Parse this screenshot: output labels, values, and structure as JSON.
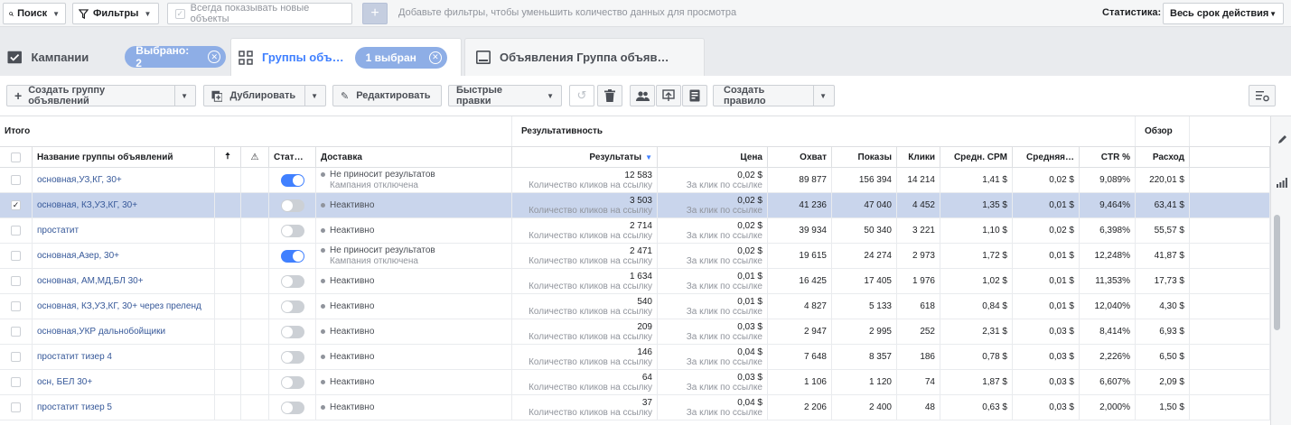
{
  "topbar": {
    "search_label": "Поиск",
    "filters_label": "Фильтры",
    "always_show_label": "Всегда показывать новые объекты",
    "add_filter_hint": "Добавьте фильтры, чтобы уменьшить количество данных для просмотра",
    "stats_label": "Статистика:",
    "stats_value": "Весь срок действия"
  },
  "tabs": {
    "campaigns": "Кампании",
    "campaigns_selected": "Выбрано: 2",
    "adsets": "Группы объ…",
    "adsets_selected": "1 выбран",
    "ads": "Объявления Группа объяв…"
  },
  "toolbar": {
    "create": "Создать группу объявлений",
    "duplicate": "Дублировать",
    "edit": "Редактировать",
    "quick_edit": "Быстрые правки",
    "create_rule": "Создать правило"
  },
  "table": {
    "band": {
      "total": "Итого",
      "performance": "Результативность",
      "overview": "Обзор"
    },
    "headers": {
      "name": "Название группы объявлений",
      "status": "Стат…",
      "delivery": "Доставка",
      "results": "Результаты",
      "price": "Цена",
      "reach": "Охват",
      "impressions": "Показы",
      "clicks": "Клики",
      "cpm": "Средн. CPM",
      "avg": "Средняя…",
      "ctr": "CTR %",
      "spend": "Расход"
    },
    "rows": [
      {
        "name": "основная,УЗ,КГ, 30+",
        "on": true,
        "selected": false,
        "d1": "Не приносит результатов",
        "d2": "Кампания отключена",
        "results": "12 583",
        "results_sub": "Количество кликов на ссылку",
        "price": "0,02 $",
        "price_sub": "За клик по ссылке",
        "reach": "89 877",
        "impr": "156 394",
        "clicks": "14 214",
        "cpm": "1,41 $",
        "avg": "0,02 $",
        "ctr": "9,089%",
        "spend": "220,01 $"
      },
      {
        "name": "основная, КЗ,УЗ,КГ, 30+",
        "on": false,
        "selected": true,
        "d1": "Неактивно",
        "d2": "",
        "results": "3 503",
        "results_sub": "Количество кликов на ссылку",
        "price": "0,02 $",
        "price_sub": "За клик по ссылке",
        "reach": "41 236",
        "impr": "47 040",
        "clicks": "4 452",
        "cpm": "1,35 $",
        "avg": "0,01 $",
        "ctr": "9,464%",
        "spend": "63,41 $"
      },
      {
        "name": "простатит",
        "on": false,
        "selected": false,
        "d1": "Неактивно",
        "d2": "",
        "results": "2 714",
        "results_sub": "Количество кликов на ссылку",
        "price": "0,02 $",
        "price_sub": "За клик по ссылке",
        "reach": "39 934",
        "impr": "50 340",
        "clicks": "3 221",
        "cpm": "1,10 $",
        "avg": "0,02 $",
        "ctr": "6,398%",
        "spend": "55,57 $"
      },
      {
        "name": "основная,Азер, 30+",
        "on": true,
        "selected": false,
        "d1": "Не приносит результатов",
        "d2": "Кампания отключена",
        "results": "2 471",
        "results_sub": "Количество кликов на ссылку",
        "price": "0,02 $",
        "price_sub": "За клик по ссылке",
        "reach": "19 615",
        "impr": "24 274",
        "clicks": "2 973",
        "cpm": "1,72 $",
        "avg": "0,01 $",
        "ctr": "12,248%",
        "spend": "41,87 $"
      },
      {
        "name": "основная, АМ,МД,БЛ 30+",
        "on": false,
        "selected": false,
        "d1": "Неактивно",
        "d2": "",
        "results": "1 634",
        "results_sub": "Количество кликов на ссылку",
        "price": "0,01 $",
        "price_sub": "За клик по ссылке",
        "reach": "16 425",
        "impr": "17 405",
        "clicks": "1 976",
        "cpm": "1,02 $",
        "avg": "0,01 $",
        "ctr": "11,353%",
        "spend": "17,73 $"
      },
      {
        "name": "основная, КЗ,УЗ,КГ, 30+ через преленд",
        "on": false,
        "selected": false,
        "d1": "Неактивно",
        "d2": "",
        "results": "540",
        "results_sub": "Количество кликов на ссылку",
        "price": "0,01 $",
        "price_sub": "За клик по ссылке",
        "reach": "4 827",
        "impr": "5 133",
        "clicks": "618",
        "cpm": "0,84 $",
        "avg": "0,01 $",
        "ctr": "12,040%",
        "spend": "4,30 $"
      },
      {
        "name": "основная,УКР дальнобойщики",
        "on": false,
        "selected": false,
        "d1": "Неактивно",
        "d2": "",
        "results": "209",
        "results_sub": "Количество кликов на ссылку",
        "price": "0,03 $",
        "price_sub": "За клик по ссылке",
        "reach": "2 947",
        "impr": "2 995",
        "clicks": "252",
        "cpm": "2,31 $",
        "avg": "0,03 $",
        "ctr": "8,414%",
        "spend": "6,93 $"
      },
      {
        "name": "простатит тизер 4",
        "on": false,
        "selected": false,
        "d1": "Неактивно",
        "d2": "",
        "results": "146",
        "results_sub": "Количество кликов на ссылку",
        "price": "0,04 $",
        "price_sub": "За клик по ссылке",
        "reach": "7 648",
        "impr": "8 357",
        "clicks": "186",
        "cpm": "0,78 $",
        "avg": "0,03 $",
        "ctr": "2,226%",
        "spend": "6,50 $"
      },
      {
        "name": "осн, БЕЛ 30+",
        "on": false,
        "selected": false,
        "d1": "Неактивно",
        "d2": "",
        "results": "64",
        "results_sub": "Количество кликов на ссылку",
        "price": "0,03 $",
        "price_sub": "За клик по ссылке",
        "reach": "1 106",
        "impr": "1 120",
        "clicks": "74",
        "cpm": "1,87 $",
        "avg": "0,03 $",
        "ctr": "6,607%",
        "spend": "2,09 $"
      },
      {
        "name": "простатит тизер 5",
        "on": false,
        "selected": false,
        "d1": "Неактивно",
        "d2": "",
        "results": "37",
        "results_sub": "Количество кликов на ссылку",
        "price": "0,04 $",
        "price_sub": "За клик по ссылке",
        "reach": "2 206",
        "impr": "2 400",
        "clicks": "48",
        "cpm": "0,63 $",
        "avg": "0,03 $",
        "ctr": "2,000%",
        "spend": "1,50 $"
      }
    ]
  },
  "colors": {
    "accent": "#4080ff",
    "link": "#365899",
    "selected_row": "#c9d5ec",
    "pill": "#8eaee6"
  }
}
